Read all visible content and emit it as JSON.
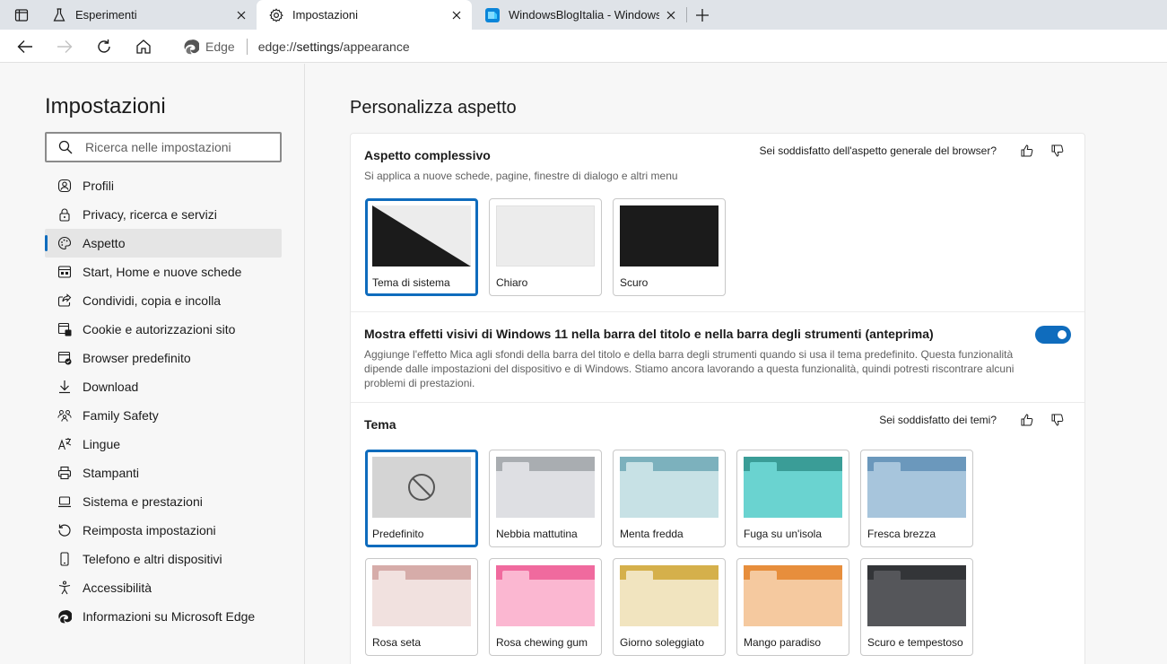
{
  "browser": {
    "tabs": [
      {
        "label": "Esperimenti",
        "icon": "flask-icon",
        "active": false
      },
      {
        "label": "Impostazioni",
        "icon": "gear-icon",
        "active": true
      },
      {
        "label": "WindowsBlogItalia - Windows, Su",
        "icon": "wbi-site-icon",
        "active": false
      }
    ],
    "address": {
      "site_label": "Edge",
      "url_prefix": "edge://",
      "url_path": "settings",
      "url_suffix": "/appearance"
    }
  },
  "sidebar": {
    "title": "Impostazioni",
    "search_placeholder": "Ricerca nelle impostazioni",
    "items": [
      {
        "label": "Profili",
        "icon": "profile-icon"
      },
      {
        "label": "Privacy, ricerca e servizi",
        "icon": "lock-icon"
      },
      {
        "label": "Aspetto",
        "icon": "palette-icon",
        "active": true
      },
      {
        "label": "Start, Home e nuove schede",
        "icon": "home-tab-icon"
      },
      {
        "label": "Condividi, copia e incolla",
        "icon": "share-icon"
      },
      {
        "label": "Cookie e autorizzazioni sito",
        "icon": "cookie-permission-icon"
      },
      {
        "label": "Browser predefinito",
        "icon": "default-browser-icon"
      },
      {
        "label": "Download",
        "icon": "download-icon"
      },
      {
        "label": "Family Safety",
        "icon": "family-icon"
      },
      {
        "label": "Lingue",
        "icon": "language-icon"
      },
      {
        "label": "Stampanti",
        "icon": "printer-icon"
      },
      {
        "label": "Sistema e prestazioni",
        "icon": "laptop-icon"
      },
      {
        "label": "Reimposta impostazioni",
        "icon": "reset-icon"
      },
      {
        "label": "Telefono e altri dispositivi",
        "icon": "phone-icon"
      },
      {
        "label": "Accessibilità",
        "icon": "accessibility-icon"
      },
      {
        "label": "Informazioni su Microsoft Edge",
        "icon": "edge-logo-icon"
      }
    ]
  },
  "main": {
    "title": "Personalizza aspetto",
    "overall": {
      "title": "Aspetto complessivo",
      "subtitle": "Si applica a nuove schede, pagine, finestre di dialogo e altri menu",
      "feedback_question": "Sei soddisfatto dell'aspetto generale del browser?",
      "options": [
        {
          "label": "Tema di sistema",
          "selected": true
        },
        {
          "label": "Chiaro",
          "selected": false
        },
        {
          "label": "Scuro",
          "selected": false
        }
      ]
    },
    "mica": {
      "title": "Mostra effetti visivi di Windows 11 nella barra del titolo e nella barra degli strumenti (anteprima)",
      "description_line1": "Aggiunge l'effetto Mica agli sfondi della barra del titolo e della barra degli strumenti quando si usa il tema predefinito. Questa funzionalità",
      "description_line2": "dipende dalle impostazioni del dispositivo e di Windows. Stiamo ancora lavorando a questa funzionalità, quindi potresti riscontrare alcuni",
      "description_line3": "problemi di prestazioni.",
      "enabled": true
    },
    "themes": {
      "title": "Tema",
      "feedback_question": "Sei soddisfatto dei temi?",
      "items": [
        {
          "label": "Predefinito",
          "selected": true,
          "top": "#d4d4d4",
          "body": "#d4d4d4",
          "tab": "#d4d4d4"
        },
        {
          "label": "Nebbia mattutina",
          "top": "#a9adb1",
          "body": "#dedfe3",
          "tab": "#dedfe3"
        },
        {
          "label": "Menta fredda",
          "top": "#7cb1bd",
          "body": "#c7e1e5",
          "tab": "#c7e1e5"
        },
        {
          "label": "Fuga su un'isola",
          "top": "#3a9d97",
          "body": "#6ad3d0",
          "tab": "#6ad3d0"
        },
        {
          "label": "Fresca brezza",
          "top": "#6b98bc",
          "body": "#a7c5dc",
          "tab": "#a7c5dc"
        },
        {
          "label": "Rosa seta",
          "top": "#d6aca9",
          "body": "#f1e1df",
          "tab": "#f1e1df"
        },
        {
          "label": "Rosa chewing gum",
          "top": "#f06a9e",
          "body": "#fbb7d1",
          "tab": "#fbb7d1"
        },
        {
          "label": "Giorno soleggiato",
          "top": "#d5b04b",
          "body": "#f1e4bf",
          "tab": "#f1e4bf"
        },
        {
          "label": "Mango paradiso",
          "top": "#e78e3c",
          "body": "#f5c99f",
          "tab": "#f5c99f"
        },
        {
          "label": "Scuro e tempestoso",
          "top": "#333538",
          "body": "#55565a",
          "tab": "#55565a"
        }
      ]
    }
  },
  "colors": {
    "accent": "#0f6cbd"
  }
}
